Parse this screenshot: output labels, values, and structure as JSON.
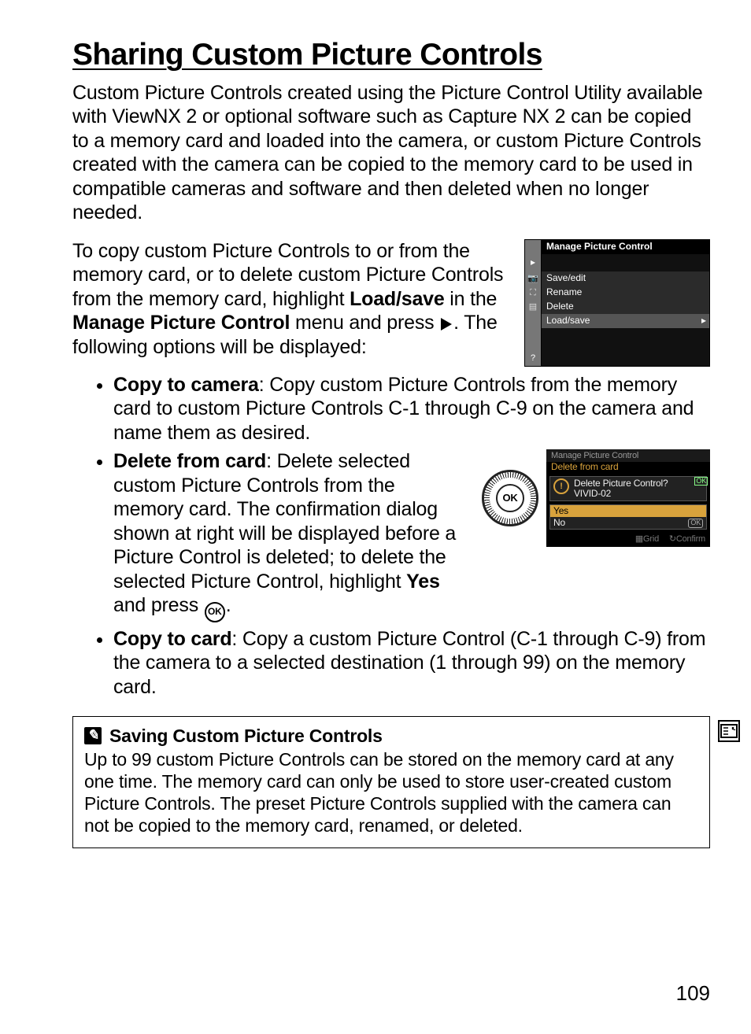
{
  "title": "Sharing Custom Picture Controls",
  "intro": "Custom Picture Controls created using the Picture Control Utility available with ViewNX 2 or optional software such as Capture NX 2 can be copied to a memory card and loaded into the camera, or custom Picture Controls created with the camera can be copied to the memory card to be used in compatible cameras and software and then deleted when no longer needed.",
  "para2": {
    "pre1": "To copy custom Picture Controls to or from the memory card, or to delete custom Picture Controls from the memory card, highlight ",
    "bold1": "Load/save",
    "mid1": " in the ",
    "bold2": "Manage Picture Control",
    "mid2": " menu and press ",
    "post": ".  The following options will be displayed:"
  },
  "options": {
    "copy_to_camera": {
      "label": "Copy to camera",
      "text": ": Copy custom Picture Controls from the memory card to custom Picture Controls C-1 through C-9 on the camera and name them as desired."
    },
    "delete_from_card": {
      "label": "Delete from card",
      "text1": ": Delete selected custom Picture Controls from the memory card.  The confirmation dialog shown at right will be displayed before a Picture Control is deleted; to delete the selected Picture Control, highlight ",
      "bold": "Yes",
      "text2": " and press ",
      "text3": "."
    },
    "copy_to_card": {
      "label": "Copy to card",
      "text": ": Copy a custom Picture Control (C-1 through C-9) from the camera to a selected destination (1 through 99) on the memory card."
    }
  },
  "screenshot1": {
    "title": "Manage Picture Control",
    "items": [
      "Save/edit",
      "Rename",
      "Delete",
      "Load/save"
    ]
  },
  "screenshot2": {
    "header1": "Manage Picture Control",
    "header2": "Delete from card",
    "dialog_line1": "Delete Picture Control?",
    "dialog_line2": "VIVID-02",
    "yes": "Yes",
    "no": "No",
    "ok": "OK",
    "foot_grid": "Grid",
    "foot_confirm": "Confirm"
  },
  "okdial": "OK",
  "tip": {
    "heading": "Saving Custom Picture Controls",
    "body": "Up to 99 custom Picture Controls can be stored on the memory card at any one time.  The memory card can only be used to store user-created custom Picture Controls.  The preset Picture Controls supplied with the camera can not be copied to the memory card, renamed, or deleted."
  },
  "page_number": "109"
}
